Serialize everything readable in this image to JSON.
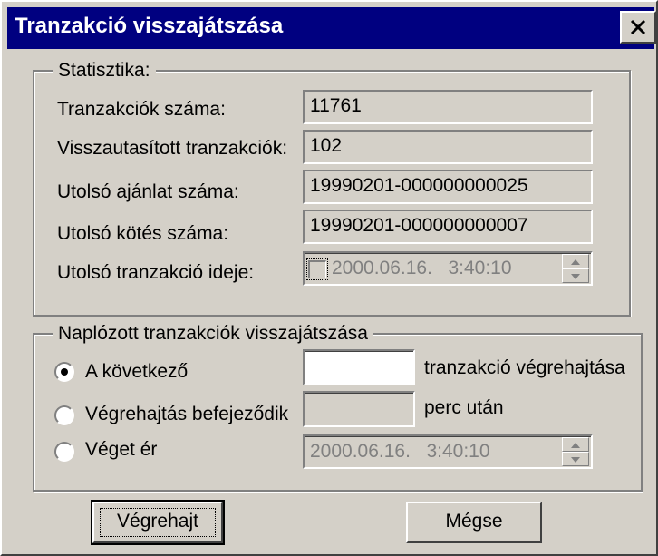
{
  "window": {
    "title": "Tranzakció visszajátszása"
  },
  "stats": {
    "legend": "Statisztika:",
    "rows": [
      {
        "label": "Tranzakciók száma:",
        "value": "11761"
      },
      {
        "label": "Visszautasított tranzakciók:",
        "value": "102"
      },
      {
        "label": "Utolsó ajánlat száma:",
        "value": "19990201-000000000025"
      },
      {
        "label": "Utolsó kötés száma:",
        "value": "19990201-000000000007"
      }
    ],
    "last_time": {
      "label": "Utolsó tranzakció ideje:",
      "value": "2000.06.16.   3:40:10",
      "checked": false,
      "enabled": false
    }
  },
  "replay": {
    "legend": "Naplózott tranzakciók visszajátszása",
    "options": [
      {
        "label": "A következő",
        "selected": true,
        "input_value": "",
        "suffix": "tranzakció végrehajtása"
      },
      {
        "label": "Végrehajtás befejeződik",
        "selected": false,
        "input_value": "",
        "suffix": "perc után"
      },
      {
        "label": "Véget ér",
        "selected": false,
        "datetime": "2000.06.16.   3:40:10"
      }
    ]
  },
  "buttons": {
    "execute": "Végrehajt",
    "cancel": "Mégse"
  }
}
